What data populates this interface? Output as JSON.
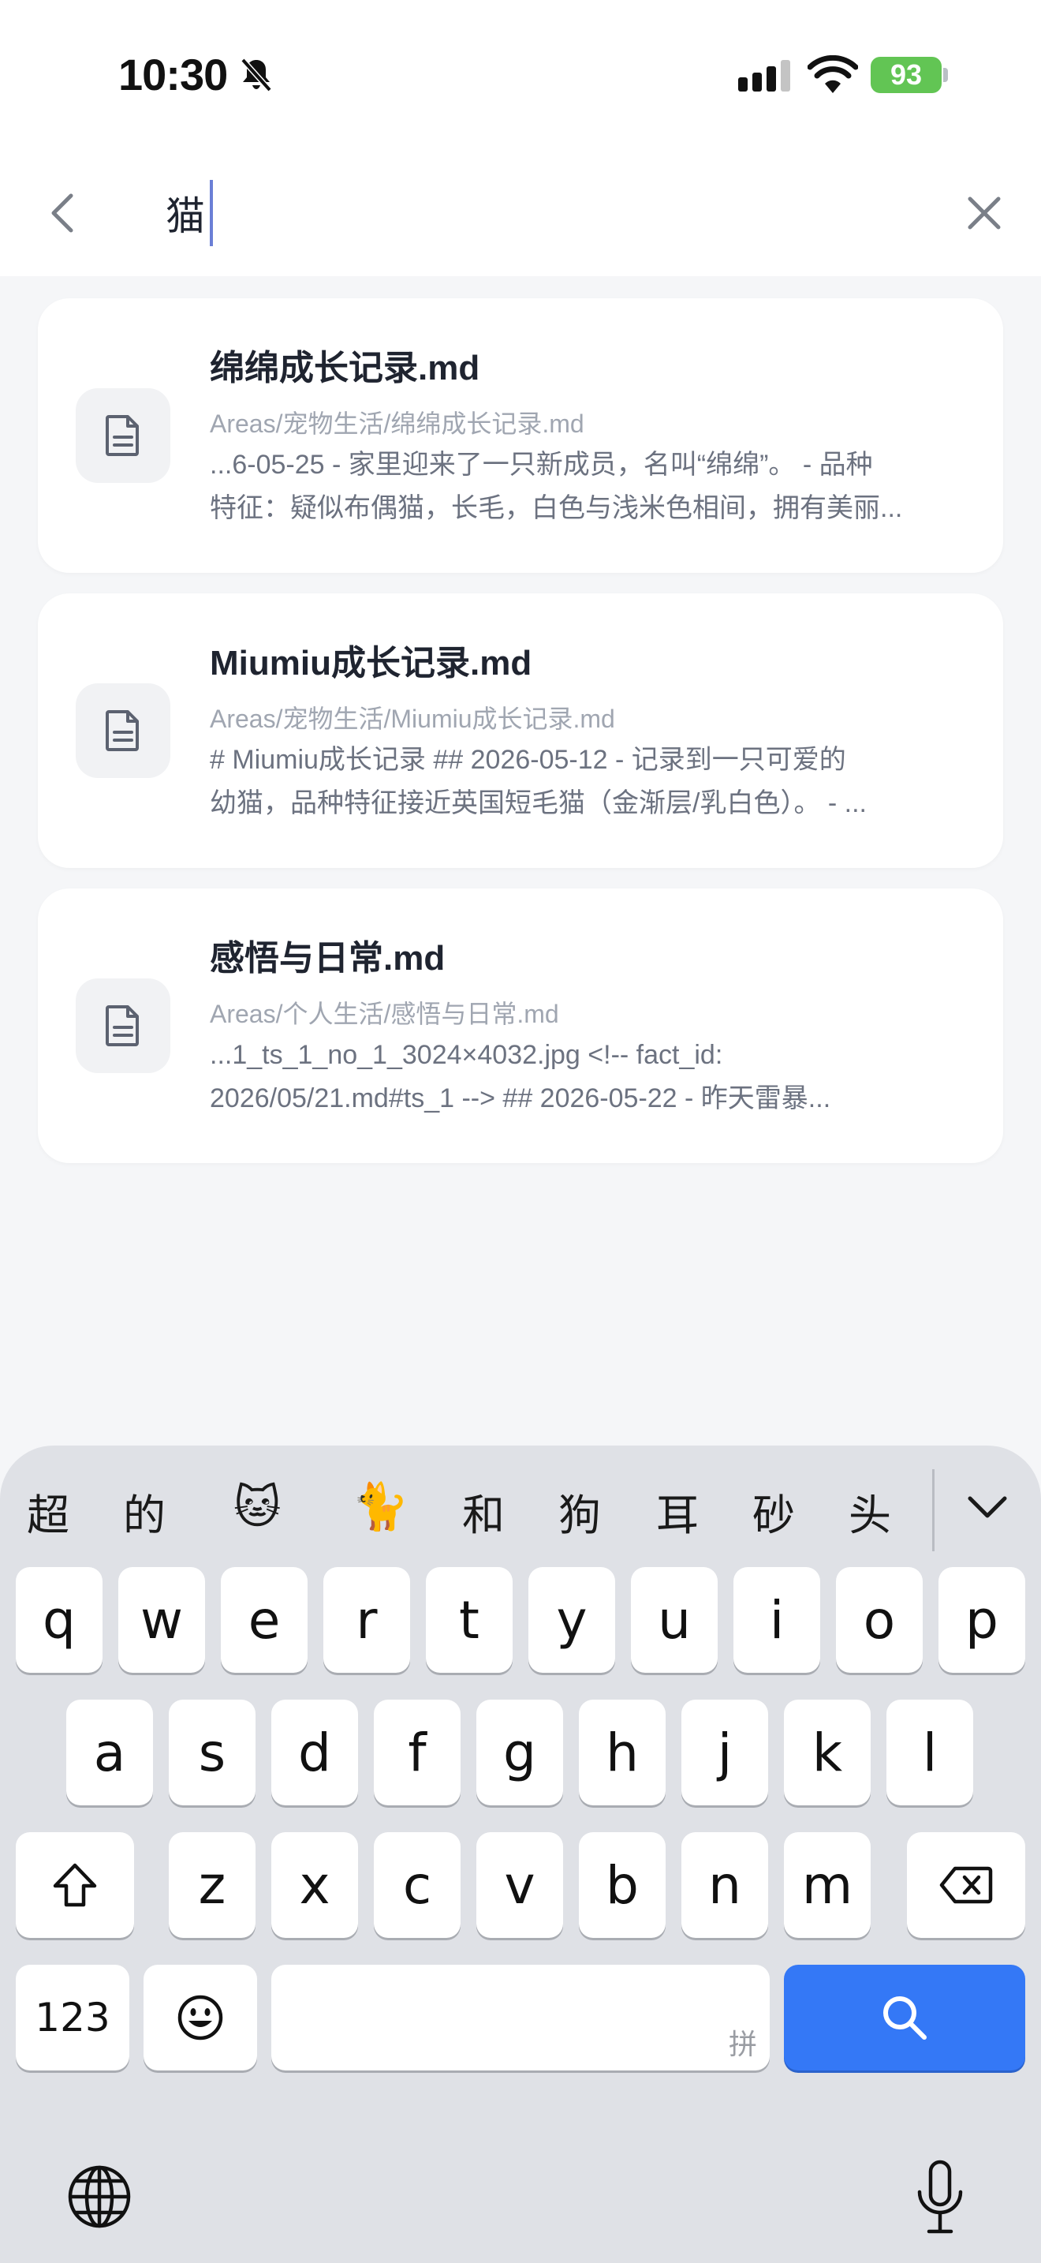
{
  "status": {
    "time": "10:30",
    "battery": "93"
  },
  "search": {
    "query": "猫"
  },
  "results": [
    {
      "title": "绵绵成长记录.md",
      "path": "Areas/宠物生活/绵绵成长记录.md",
      "snippet_line1": "...6-05-25 - 家里迎来了一只新成员，名叫“绵绵”。 - 品种",
      "snippet_line2": "特征：疑似布偶猫，长毛，白色与浅米色相间，拥有美丽..."
    },
    {
      "title": "Miumiu成长记录.md",
      "path": "Areas/宠物生活/Miumiu成长记录.md",
      "snippet_line1": "# Miumiu成长记录  ## 2026-05-12 - 记录到一只可爱的",
      "snippet_line2": "幼猫，品种特征接近英国短毛猫（金渐层/乳白色）。 - ..."
    },
    {
      "title": "感悟与日常.md",
      "path": "Areas/个人生活/感悟与日常.md",
      "snippet_line1": "...1_ts_1_no_1_3024×4032.jpg <!-- fact_id:",
      "snippet_line2": "2026/05/21.md#ts_1 -->  ## 2026-05-22 - 昨天雷暴..."
    }
  ],
  "keyboard": {
    "candidates": [
      "超",
      "的",
      "🐱",
      "🐈",
      "和",
      "狗",
      "耳",
      "砂",
      "头"
    ],
    "row1": [
      "q",
      "w",
      "e",
      "r",
      "t",
      "y",
      "u",
      "i",
      "o",
      "p"
    ],
    "row2": [
      "a",
      "s",
      "d",
      "f",
      "g",
      "h",
      "j",
      "k",
      "l"
    ],
    "row3": [
      "z",
      "x",
      "c",
      "v",
      "b",
      "n",
      "m"
    ],
    "num_label": "123",
    "space_hint": "拼"
  },
  "colors": {
    "accent": "#3478f6",
    "battery": "#62c554"
  }
}
